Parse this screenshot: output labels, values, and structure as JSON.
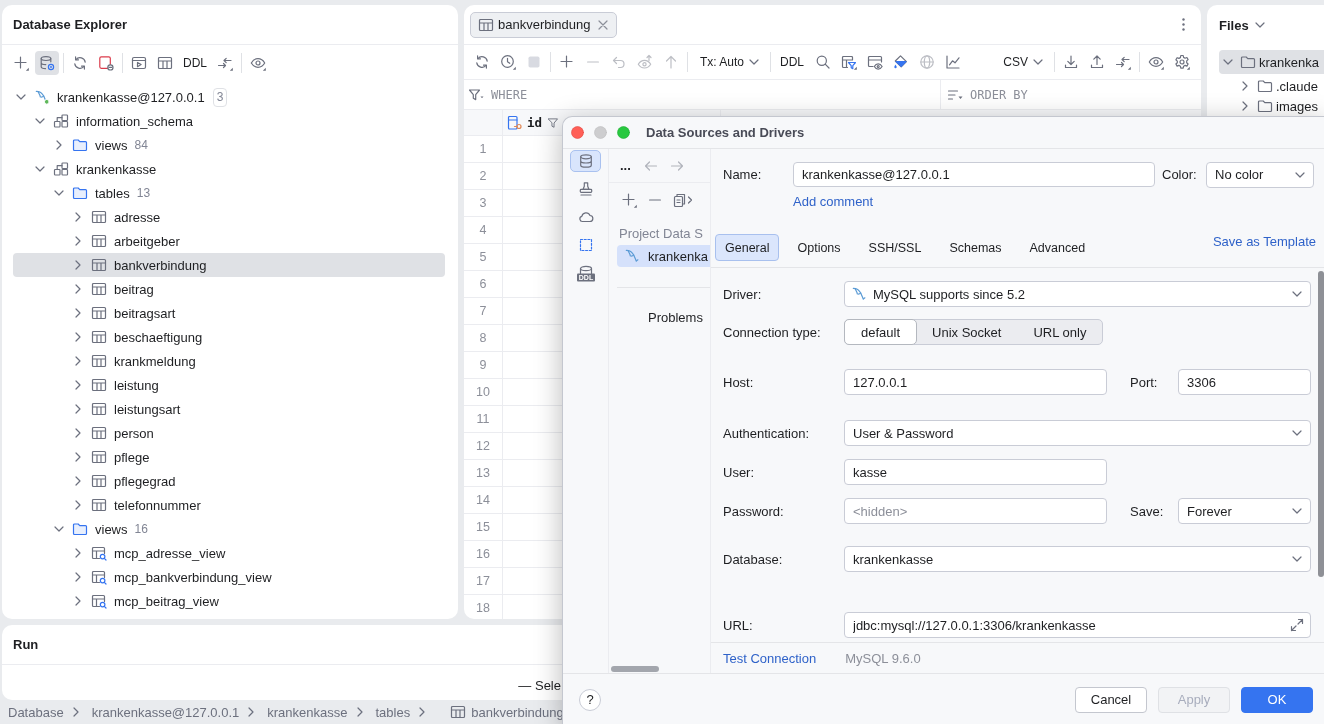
{
  "database_explorer": {
    "title": "Database Explorer",
    "toolbar": [
      {
        "kind": "icon",
        "selected": false
      },
      {
        "kind": "icon",
        "selected": true
      },
      {
        "kind": "separator"
      },
      {
        "kind": "icon",
        "selected": false
      },
      {
        "kind": "icon",
        "selected": false
      },
      {
        "kind": "separator"
      },
      {
        "kind": "icon",
        "selected": false
      },
      {
        "kind": "icon",
        "selected": false
      },
      {
        "kind": "text",
        "label": "DDL",
        "selected": false
      },
      {
        "kind": "icon",
        "selected": false
      },
      {
        "kind": "separator"
      },
      {
        "kind": "icon",
        "selected": false
      }
    ],
    "tree": [
      {
        "kind": "connection",
        "label": "krankenkasse@127.0.0.1",
        "count": "3",
        "connected": true,
        "expanded": true,
        "selected": false,
        "children": [
          {
            "kind": "schema",
            "label": "information_schema",
            "expanded": true,
            "selected": false,
            "children": [
              {
                "kind": "folder",
                "label": "views",
                "count": "84",
                "expanded": false,
                "selected": false
              }
            ]
          },
          {
            "kind": "schema",
            "label": "krankenkasse",
            "expanded": true,
            "selected": false,
            "children": [
              {
                "kind": "folder",
                "label": "tables",
                "count": "13",
                "expanded": true,
                "selected": false,
                "children": [
                  {
                    "kind": "table",
                    "label": "adresse",
                    "expanded": false,
                    "selected": false
                  },
                  {
                    "kind": "table",
                    "label": "arbeitgeber",
                    "expanded": false,
                    "selected": false
                  },
                  {
                    "kind": "table",
                    "label": "bankverbindung",
                    "expanded": false,
                    "selected": true
                  },
                  {
                    "kind": "table",
                    "label": "beitrag",
                    "expanded": false,
                    "selected": false
                  },
                  {
                    "kind": "table",
                    "label": "beitragsart",
                    "expanded": false,
                    "selected": false
                  },
                  {
                    "kind": "table",
                    "label": "beschaeftigung",
                    "expanded": false,
                    "selected": false
                  },
                  {
                    "kind": "table",
                    "label": "krankmeldung",
                    "expanded": false,
                    "selected": false
                  },
                  {
                    "kind": "table",
                    "label": "leistung",
                    "expanded": false,
                    "selected": false
                  },
                  {
                    "kind": "table",
                    "label": "leistungsart",
                    "expanded": false,
                    "selected": false
                  },
                  {
                    "kind": "table",
                    "label": "person",
                    "expanded": false,
                    "selected": false
                  },
                  {
                    "kind": "table",
                    "label": "pflege",
                    "expanded": false,
                    "selected": false
                  },
                  {
                    "kind": "table",
                    "label": "pflegegrad",
                    "expanded": false,
                    "selected": false
                  },
                  {
                    "kind": "table",
                    "label": "telefonnummer",
                    "expanded": false,
                    "selected": false
                  }
                ]
              },
              {
                "kind": "folder",
                "label": "views",
                "count": "16",
                "expanded": true,
                "selected": false,
                "children": [
                  {
                    "kind": "view",
                    "label": "mcp_adresse_view",
                    "expanded": false,
                    "selected": false
                  },
                  {
                    "kind": "view",
                    "label": "mcp_bankverbindung_view",
                    "expanded": false,
                    "selected": false
                  },
                  {
                    "kind": "view",
                    "label": "mcp_beitrag_view",
                    "expanded": false,
                    "selected": false
                  }
                ]
              }
            ]
          }
        ]
      }
    ]
  },
  "editor": {
    "tabs": [
      {
        "label": "bankverbindung",
        "selected": true
      }
    ],
    "toolbar": {
      "left": [
        {
          "kind": "icon",
          "disabled": false
        },
        {
          "kind": "icon",
          "disabled": false
        },
        {
          "kind": "icon",
          "disabled": true
        },
        {
          "kind": "separator"
        },
        {
          "kind": "icon",
          "disabled": false
        },
        {
          "kind": "icon",
          "disabled": true
        },
        {
          "kind": "icon",
          "disabled": true
        },
        {
          "kind": "icon",
          "disabled": true
        },
        {
          "kind": "icon",
          "disabled": true
        },
        {
          "kind": "separator"
        },
        {
          "kind": "dropdown",
          "label": "Tx: Auto"
        },
        {
          "kind": "separator"
        },
        {
          "kind": "text",
          "label": "DDL",
          "disabled": false
        },
        {
          "kind": "icon",
          "disabled": false
        },
        {
          "kind": "icon",
          "disabled": false
        },
        {
          "kind": "icon",
          "disabled": false
        },
        {
          "kind": "icon",
          "disabled": false
        },
        {
          "kind": "icon",
          "disabled": true
        },
        {
          "kind": "icon",
          "disabled": false
        }
      ],
      "right": [
        {
          "kind": "dropdown",
          "label": "CSV"
        },
        {
          "kind": "separator"
        },
        {
          "kind": "icon",
          "disabled": false
        },
        {
          "kind": "icon",
          "disabled": false
        },
        {
          "kind": "icon",
          "disabled": false
        },
        {
          "kind": "separator"
        },
        {
          "kind": "icon",
          "disabled": false
        },
        {
          "kind": "icon",
          "disabled": false
        }
      ]
    },
    "filters": [
      {
        "kind": "where",
        "placeholder": "WHERE"
      },
      {
        "kind": "order_by",
        "placeholder": "ORDER BY"
      }
    ],
    "grid": {
      "columns": [
        {
          "label": "id"
        }
      ],
      "row_numbers": [
        "1",
        "2",
        "3",
        "4",
        "5",
        "6",
        "7",
        "8",
        "9",
        "10",
        "11",
        "12",
        "13",
        "14",
        "15",
        "16",
        "17",
        "18"
      ]
    }
  },
  "files": {
    "title": "Files",
    "tree": [
      {
        "label": "krankenka",
        "expanded": true,
        "selected": true,
        "children": [
          {
            "label": ".claude",
            "expanded": false,
            "selected": false
          },
          {
            "label": "images",
            "expanded": false,
            "selected": false
          }
        ]
      }
    ]
  },
  "run": {
    "title": "Run",
    "lines": [
      "— Sele"
    ]
  },
  "status_bar": {
    "breadcrumbs": [
      {
        "kind": "text",
        "label": "Database"
      },
      {
        "kind": "text",
        "label": "krankenkasse@127.0.0.1"
      },
      {
        "kind": "text",
        "label": "krankenkasse"
      },
      {
        "kind": "text",
        "label": "tables"
      },
      {
        "kind": "table",
        "label": "bankverbindung"
      }
    ]
  },
  "dialog": {
    "title": "Data Sources and Drivers",
    "sections": [
      {
        "selected": true
      },
      {
        "selected": false
      },
      {
        "selected": false
      },
      {
        "selected": false
      },
      {
        "selected": false,
        "badge": "DDL"
      }
    ],
    "navigator": {
      "more_label": "...",
      "group_label": "Project Data S",
      "items": [
        {
          "label": "krankenka",
          "selected": true
        }
      ],
      "problems_label": "Problems"
    },
    "name": {
      "label": "Name:",
      "value": "krankenkasse@127.0.0.1"
    },
    "color": {
      "label": "Color:",
      "value": "No color"
    },
    "add_comment": "Add comment",
    "tabs": [
      {
        "label": "General",
        "selected": true
      },
      {
        "label": "Options",
        "selected": false
      },
      {
        "label": "SSH/SSL",
        "selected": false
      },
      {
        "label": "Schemas",
        "selected": false
      },
      {
        "label": "Advanced",
        "selected": false
      }
    ],
    "save_as_template": "Save as Template",
    "driver": {
      "label": "Driver:",
      "value": "MySQL supports since 5.2"
    },
    "connection_type": {
      "label": "Connection type:",
      "options": [
        {
          "label": "default",
          "selected": true
        },
        {
          "label": "Unix Socket",
          "selected": false
        },
        {
          "label": "URL only",
          "selected": false
        }
      ]
    },
    "host": {
      "label": "Host:",
      "value": "127.0.0.1"
    },
    "port": {
      "label": "Port:",
      "value": "3306"
    },
    "authentication": {
      "label": "Authentication:",
      "value": "User & Password"
    },
    "user": {
      "label": "User:",
      "value": "kasse"
    },
    "password": {
      "label": "Password:",
      "placeholder": "<hidden>"
    },
    "save": {
      "label": "Save:",
      "value": "Forever"
    },
    "database": {
      "label": "Database:",
      "value": "krankenkasse"
    },
    "url": {
      "label": "URL:",
      "value": "jdbc:mysql://127.0.0.1:3306/krankenkasse"
    },
    "test_connection": "Test Connection",
    "server_version": "MySQL 9.6.0",
    "help_label": "?",
    "buttons": [
      {
        "kind": "secondary",
        "label": "Cancel",
        "disabled": false
      },
      {
        "kind": "secondary",
        "label": "Apply",
        "disabled": true
      },
      {
        "kind": "primary",
        "label": "OK",
        "disabled": false
      }
    ]
  }
}
